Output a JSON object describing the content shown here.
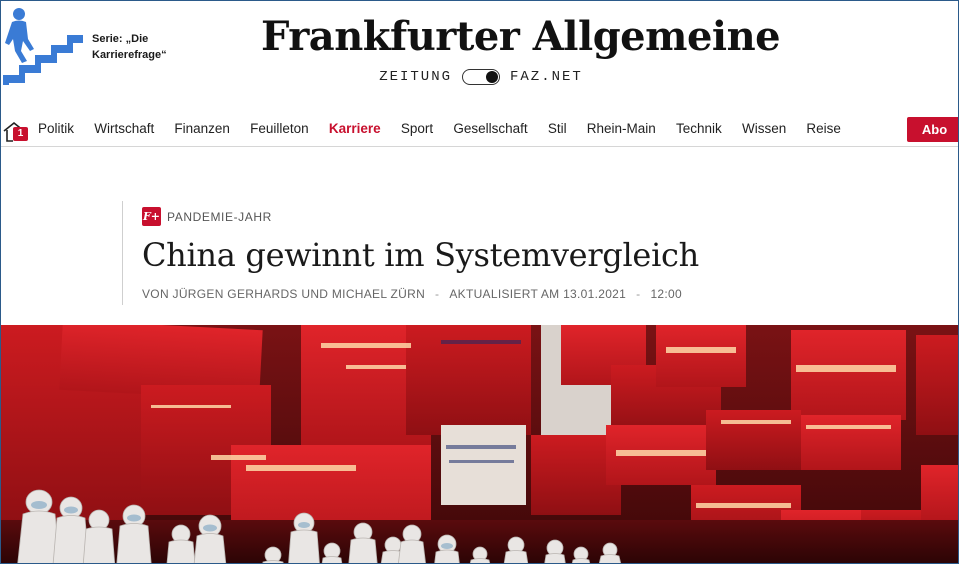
{
  "header": {
    "series_label_line1": "Serie: „Die",
    "series_label_line2": "Karrierefrage“",
    "logo_text": "Frankfurter Allgemeine",
    "edition_left": "ZEITUNG",
    "edition_right": "FAZ.NET"
  },
  "nav": {
    "home_badge": "1",
    "items": [
      {
        "label": "Politik"
      },
      {
        "label": "Wirtschaft"
      },
      {
        "label": "Finanzen"
      },
      {
        "label": "Feuilleton"
      },
      {
        "label": "Karriere",
        "active": true
      },
      {
        "label": "Sport"
      },
      {
        "label": "Gesellschaft"
      },
      {
        "label": "Stil"
      },
      {
        "label": "Rhein-Main"
      },
      {
        "label": "Technik"
      },
      {
        "label": "Wissen"
      },
      {
        "label": "Reise"
      }
    ],
    "abo_label": "Abo"
  },
  "article": {
    "plus_badge": "F+",
    "kicker": "PANDEMIE-JAHR",
    "headline": "China gewinnt im Systemvergleich",
    "author": "VON JÜRGEN GERHARDS UND MICHAEL ZÜRN",
    "separator": "-",
    "updated": "AKTUALISIERT AM 13.01.2021",
    "time": "12:00"
  },
  "colors": {
    "brand_red": "#c8102e",
    "series_icon_blue": "#3a7bd5"
  },
  "icons": {
    "series": "stair-climber-icon",
    "home": "home-icon",
    "toggle": "edition-toggle"
  }
}
